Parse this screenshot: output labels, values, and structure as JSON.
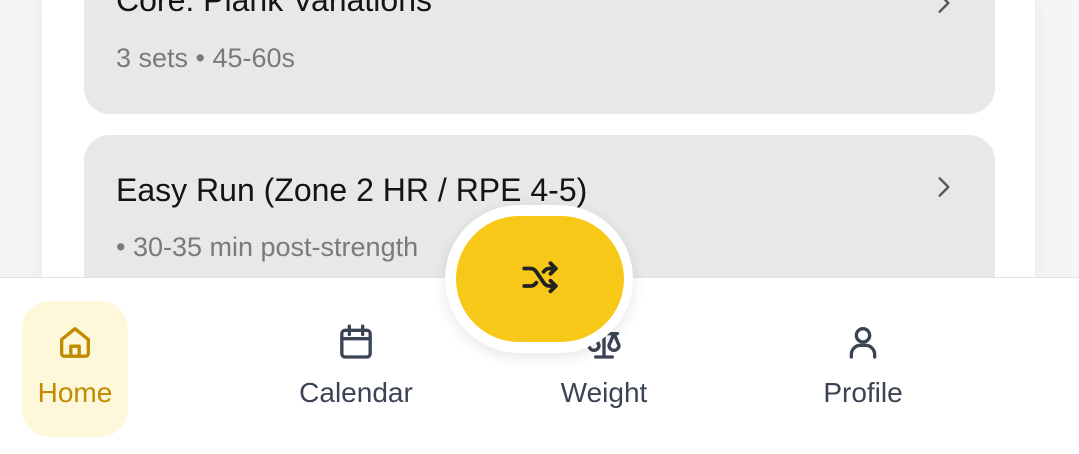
{
  "workout": {
    "items": [
      {
        "title": "Core: Plank Variations",
        "subtitle": "3 sets • 45-60s"
      },
      {
        "title": "Easy Run (Zone 2 HR / RPE 4-5)",
        "subtitle": "• 30-35 min post-strength"
      }
    ]
  },
  "fab": {
    "icon": "shuffle-icon",
    "color": "#f7c818"
  },
  "bottom_nav": {
    "items": [
      {
        "label": "Home",
        "icon": "home-icon",
        "active": true
      },
      {
        "label": "Calendar",
        "icon": "calendar-icon",
        "active": false
      },
      {
        "label": "Weight",
        "icon": "scale-icon",
        "active": false
      },
      {
        "label": "Profile",
        "icon": "user-icon",
        "active": false
      }
    ],
    "active_color": "#c28a00",
    "active_background": "#fef8db",
    "inactive_color": "#3b4453"
  }
}
